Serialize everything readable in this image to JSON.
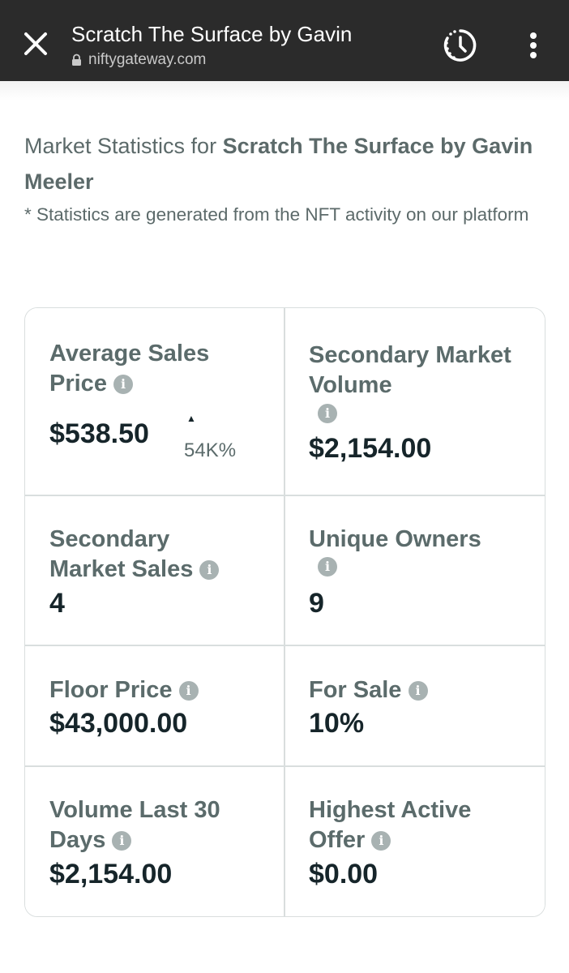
{
  "browser": {
    "title": "Scratch The Surface by Gavin",
    "url": "niftygateway.com",
    "close_icon": "close-icon",
    "history_icon": "history-clock-icon",
    "menu_icon": "more-vert-icon"
  },
  "intro": {
    "prefix": "Market Statistics for ",
    "collection": "Scratch The Surface by Gavin Meeler",
    "note": "* Statistics are generated from the NFT activity on our platform"
  },
  "stats": {
    "avg_sales_price": {
      "label": "Average Sales Price",
      "value": "$538.50",
      "change": "54K%"
    },
    "secondary_volume": {
      "label": "Secondary Market Volume",
      "value": "$2,154.00"
    },
    "secondary_sales": {
      "label": "Secondary Market Sales",
      "value": "4"
    },
    "unique_owners": {
      "label": "Unique Owners",
      "value": "9"
    },
    "floor_price": {
      "label": "Floor Price",
      "value": "$43,000.00"
    },
    "for_sale": {
      "label": "For Sale",
      "value": "10%"
    },
    "volume_30d": {
      "label": "Volume Last 30 Days",
      "value": "$2,154.00"
    },
    "highest_offer": {
      "label": "Highest Active Offer",
      "value": "$0.00"
    }
  },
  "colors": {
    "toolbar": "#2b2b2b",
    "label_text": "#5b6b6b",
    "value_text": "#16252a",
    "info_icon": "#a8b2b2",
    "border": "#d9dede"
  }
}
